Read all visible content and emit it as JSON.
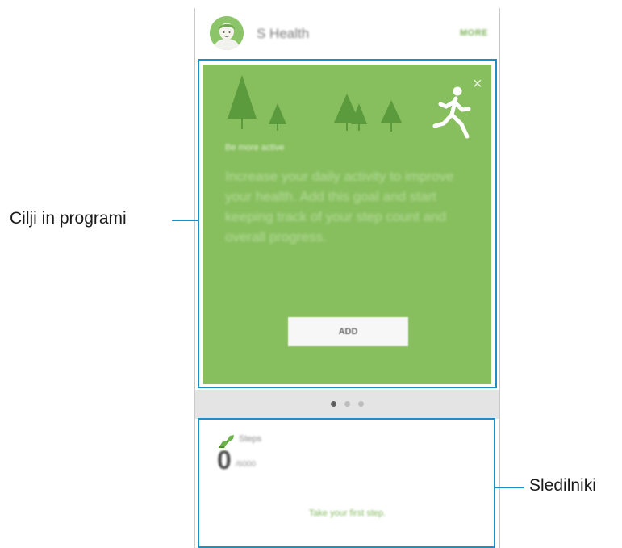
{
  "app": {
    "title": "S Health",
    "more_label": "MORE"
  },
  "goal_card": {
    "label": "Be more active",
    "description": "Increase your daily activity to improve your health. Add this goal and start keeping track of your step count and overall progress.",
    "add_label": "ADD",
    "close_icon": "close-icon",
    "close_glyph": "×"
  },
  "pager": {
    "total_pages": 3,
    "active_index": 0
  },
  "tracker": {
    "label": "Steps",
    "count": "0",
    "target": "/6000",
    "message": "Take your first step."
  },
  "callouts": {
    "goals_label": "Cilji in programi",
    "trackers_label": "Sledilniki"
  },
  "colors": {
    "card_green": "#87bf5e",
    "tree_green": "#5c9a3e",
    "accent_blue": "#1b8fc7",
    "pager_band": "#e4e4e4"
  }
}
